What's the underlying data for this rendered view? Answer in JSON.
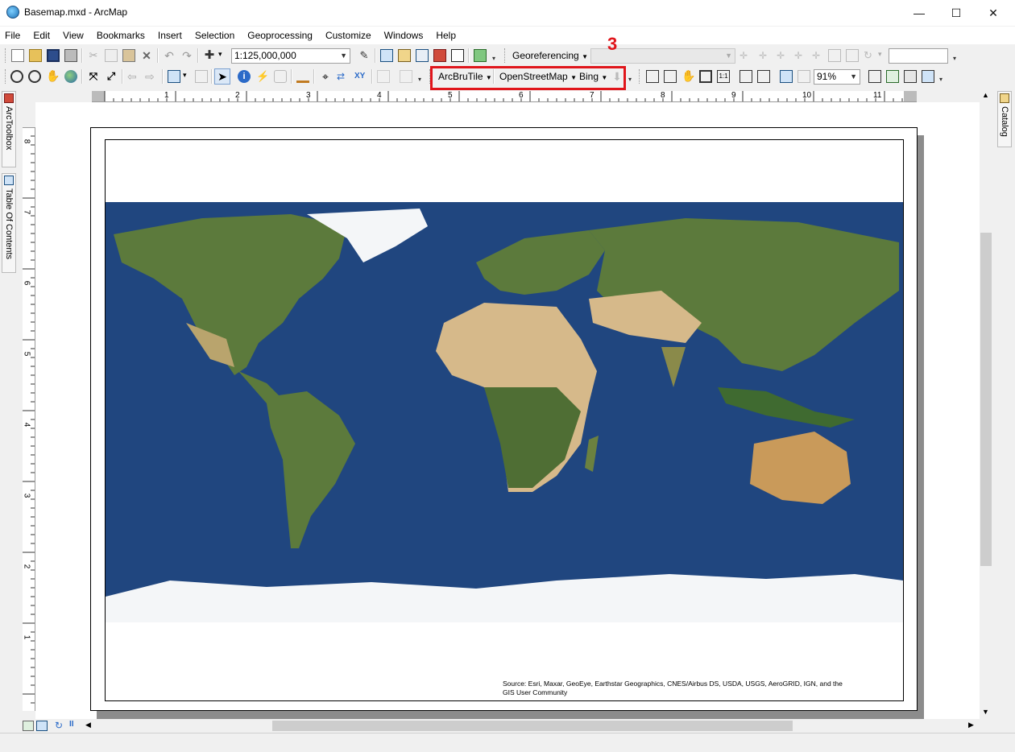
{
  "window": {
    "title": "Basemap.mxd - ArcMap",
    "minimize": "—",
    "maximize": "☐",
    "close": "✕"
  },
  "menu": [
    "File",
    "Edit",
    "View",
    "Bookmarks",
    "Insert",
    "Selection",
    "Geoprocessing",
    "Customize",
    "Windows",
    "Help"
  ],
  "standard_toolbar": {
    "scale_value": "1:125,000,000",
    "georeferencing_label": "Georeferencing"
  },
  "tools_toolbar": {
    "arcbrutile_label": "ArcBruTile",
    "openstreetmap_label": "OpenStreetMap",
    "bing_label": "Bing",
    "zoom_value": "91%"
  },
  "annotation": {
    "number": "3",
    "color": "#e0151b"
  },
  "left_panels": {
    "arctoolbox": "ArcToolbox",
    "table_of_contents": "Table Of Contents"
  },
  "right_panels": {
    "catalog": "Catalog"
  },
  "rulers": {
    "horizontal": [
      "1",
      "2",
      "3",
      "4",
      "5",
      "6",
      "7",
      "8",
      "9",
      "10",
      "11"
    ],
    "vertical": [
      "8",
      "7",
      "6",
      "5",
      "4",
      "3",
      "2",
      "1"
    ]
  },
  "map": {
    "attribution_line1": "Source: Esri, Maxar, GeoEye, Earthstar Geographics, CNES/Airbus DS, USDA, USGS, AeroGRID, IGN, and the",
    "attribution_line2": "GIS User Community",
    "ocean_color": "#1c3f78",
    "land_color": "#5c7a3c",
    "desert_color": "#d6b98a",
    "ice_color": "#f4f6f8"
  }
}
